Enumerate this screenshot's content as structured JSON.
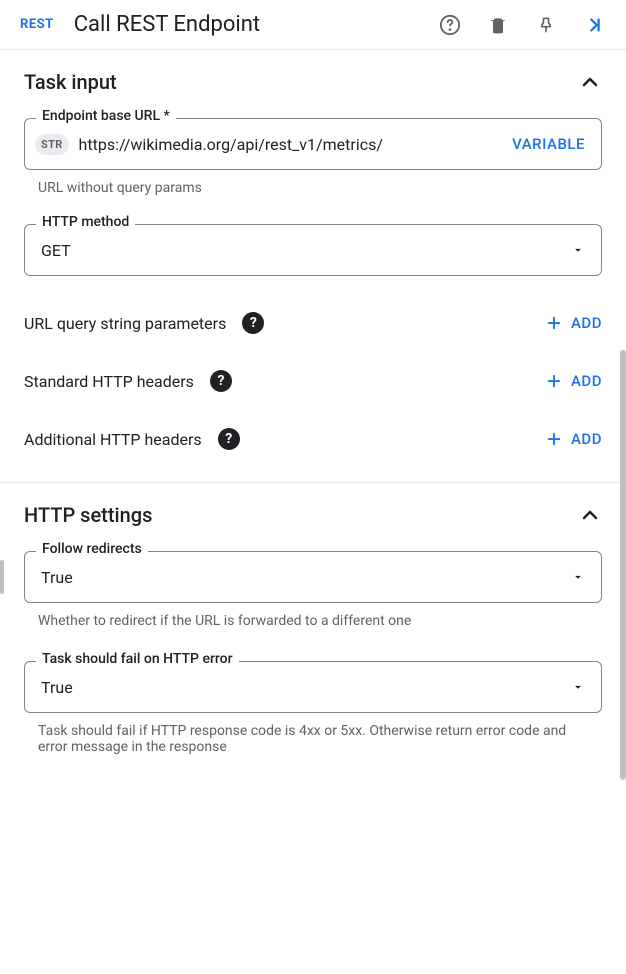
{
  "header": {
    "badge": "REST",
    "title": "Call REST Endpoint"
  },
  "taskInput": {
    "title": "Task input",
    "endpoint": {
      "label": "Endpoint base URL *",
      "typeBadge": "STR",
      "value": "https://wikimedia.org/api/rest_v1/metrics/",
      "variableBtn": "VARIABLE",
      "helper": "URL without query params"
    },
    "httpMethod": {
      "label": "HTTP method",
      "value": "GET"
    },
    "rows": {
      "queryParams": "URL query string parameters",
      "standardHeaders": "Standard HTTP headers",
      "additionalHeaders": "Additional HTTP headers",
      "addBtn": "ADD"
    }
  },
  "httpSettings": {
    "title": "HTTP settings",
    "followRedirects": {
      "label": "Follow redirects",
      "value": "True",
      "helper": "Whether to redirect if the URL is forwarded to a different one"
    },
    "failOnError": {
      "label": "Task should fail on HTTP error",
      "value": "True",
      "helper": "Task should fail if HTTP response code is 4xx or 5xx. Otherwise return error code and error message in the response"
    }
  }
}
